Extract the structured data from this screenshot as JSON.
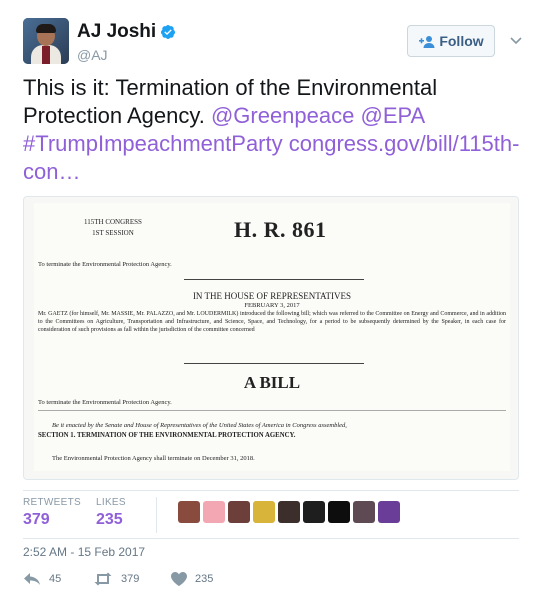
{
  "author": {
    "display_name": "AJ Joshi",
    "handle": "@AJ",
    "verified": true
  },
  "follow_button": {
    "label": "Follow"
  },
  "tweet": {
    "text_plain": "This is it: Termination of the Environmental Protection Agency.",
    "mention_greenpeace": "@Greenpeace",
    "mention_epa": "@EPA",
    "hashtag": "#TrumpImpeachmentParty",
    "link": "congress.gov/bill/115th-con…"
  },
  "document": {
    "congress": "115TH CONGRESS",
    "session": "1ST SESSION",
    "bill_number": "H. R. 861",
    "purpose": "To terminate the Environmental Protection Agency.",
    "house": "IN THE HOUSE OF REPRESENTATIVES",
    "date": "FEBRUARY 3, 2017",
    "introduction": "Mr. GAETZ (for himself, Mr. MASSIE, Mr. PALAZZO, and Mr. LOUDERMILK) introduced the following bill; which was referred to the Committee on Energy and Commerce, and in addition to the Committees on Agriculture, Transportation and Infrastructure, and Science, Space, and Technology, for a period to be subsequently determined by the Speaker, in each case for consideration of such provisions as fall within the jurisdiction of the committee concerned",
    "heading": "A BILL",
    "purpose_repeat": "To terminate the Environmental Protection Agency.",
    "enacting_clause": "Be it enacted by the Senate and House of Representatives of the United States of America in Congress assembled,",
    "section": "SECTION 1. TERMINATION OF THE ENVIRONMENTAL PROTECTION AGENCY.",
    "section_text": "The Environmental Protection Agency shall terminate on December 31, 2018."
  },
  "stats": {
    "retweets_label": "RETWEETS",
    "retweets": "379",
    "likes_label": "LIKES",
    "likes": "235"
  },
  "likers": [
    "#8a4b3f",
    "#f2a7b3",
    "#6d3f3a",
    "#d8b43a",
    "#3c2e2b",
    "#1e1e1e",
    "#0d0d0d",
    "#5e4a52",
    "#6a3d98"
  ],
  "timestamp": "2:52 AM - 15 Feb 2017",
  "actions": {
    "replies": "45",
    "retweets": "379",
    "likes": "235"
  },
  "colors": {
    "link": "#9060d8",
    "verified": "#1da1f2",
    "follow_text": "#3b5e85"
  }
}
